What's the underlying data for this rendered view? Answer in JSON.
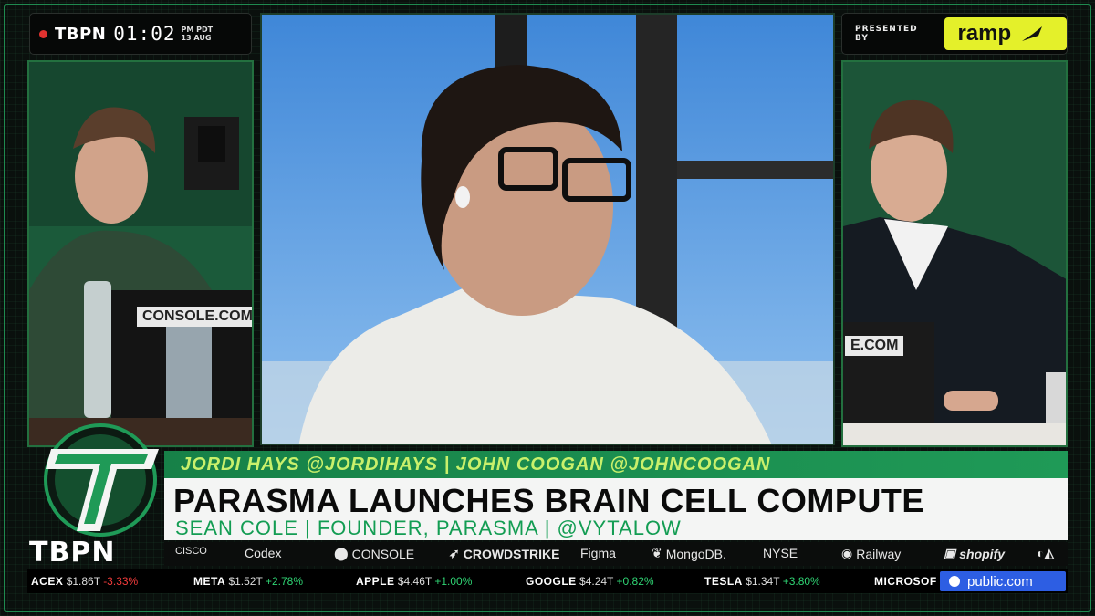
{
  "brand": {
    "name": "TBPN",
    "logo_big": "TBPN"
  },
  "clock": {
    "time": "01:02",
    "period": "PM PDT",
    "date": "13 AUG"
  },
  "sponsor": {
    "presented_by": "PRESENTED BY",
    "name": "ramp"
  },
  "panels": {
    "left_screen_label": "CONSOLE.COM",
    "right_screen_label": "E.COM"
  },
  "lower_third": {
    "hosts": "JORDI HAYS @JORDIHAYS | JOHN COOGAN @JOHNCOOGAN",
    "headline": "PARASMA LAUNCHES BRAIN CELL COMPUTE",
    "guest": "SEAN COLE | FOUNDER, PARASMA | @VYTALOW"
  },
  "sponsors_strip": [
    "CISCO",
    "Codex",
    "CONSOLE",
    "CROWDSTRIKE",
    "Figma",
    "MongoDB.",
    "NYSE",
    "Railway",
    "shopify"
  ],
  "ticker": [
    {
      "symbol": "ACEX",
      "cap": "$1.86T",
      "change": "-3.33%",
      "dir": "down"
    },
    {
      "symbol": "META",
      "cap": "$1.52T",
      "change": "+2.78%",
      "dir": "up"
    },
    {
      "symbol": "APPLE",
      "cap": "$4.46T",
      "change": "+1.00%",
      "dir": "up"
    },
    {
      "symbol": "GOOGLE",
      "cap": "$4.24T",
      "change": "+0.82%",
      "dir": "up"
    },
    {
      "symbol": "TESLA",
      "cap": "$1.34T",
      "change": "+3.80%",
      "dir": "up"
    },
    {
      "symbol": "MICROSOF",
      "cap": "",
      "change": "",
      "dir": "up"
    }
  ],
  "ticker_sponsor": "public.com",
  "colors": {
    "accent_green": "#1f9a57",
    "name_text": "#c9f06b",
    "guest_text": "#139d53",
    "ramp_yellow": "#e4f02a",
    "up": "#2fd373",
    "down": "#f23b3b",
    "public_blue": "#2d5ee3"
  }
}
